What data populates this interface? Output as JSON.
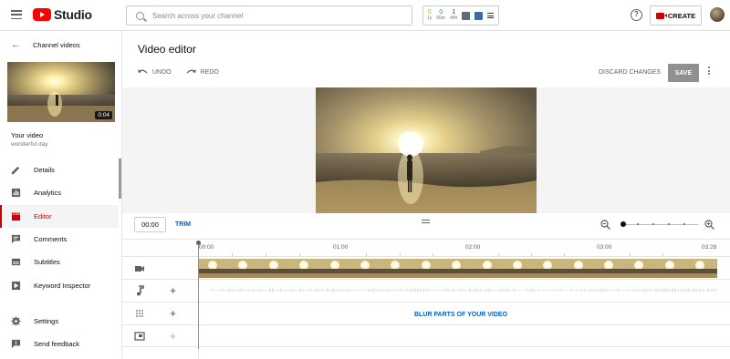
{
  "header": {
    "brand": "Studio",
    "search_placeholder": "Search across your channel",
    "extension_stats": [
      {
        "value": "0",
        "label": "1y"
      },
      {
        "value": "0",
        "label": "60m"
      },
      {
        "value": "1",
        "label": "48h"
      }
    ],
    "create_label": "CREATE"
  },
  "sidebar": {
    "back_label": "Channel videos",
    "thumbnail_duration": "0:04",
    "video_title": "Your video",
    "video_subtitle": "wonderful day",
    "nav_items": [
      {
        "label": "Details",
        "icon": "pencil-icon"
      },
      {
        "label": "Analytics",
        "icon": "bar-chart-icon"
      },
      {
        "label": "Editor",
        "icon": "clapperboard-icon"
      },
      {
        "label": "Comments",
        "icon": "comment-icon"
      },
      {
        "label": "Subtitles",
        "icon": "subtitles-icon"
      },
      {
        "label": "Keyword Inspector",
        "icon": "play-square-icon"
      }
    ],
    "bottom_items": [
      {
        "label": "Settings",
        "icon": "gear-icon"
      },
      {
        "label": "Send feedback",
        "icon": "feedback-icon"
      }
    ]
  },
  "editor": {
    "title": "Video editor",
    "undo_label": "UNDO",
    "redo_label": "REDO",
    "discard_label": "DISCARD CHANGES",
    "save_label": "SAVE",
    "time_value": "00:00",
    "trim_label": "TRIM",
    "ruler_labels": [
      "00:00",
      "01:00",
      "02:00",
      "03:00",
      "03:28"
    ],
    "blur_label": "BLUR PARTS OF YOUR VIDEO"
  },
  "colors": {
    "accent_red": "#cc0000",
    "link_blue": "#065fd4",
    "save_disabled": "#909090"
  }
}
